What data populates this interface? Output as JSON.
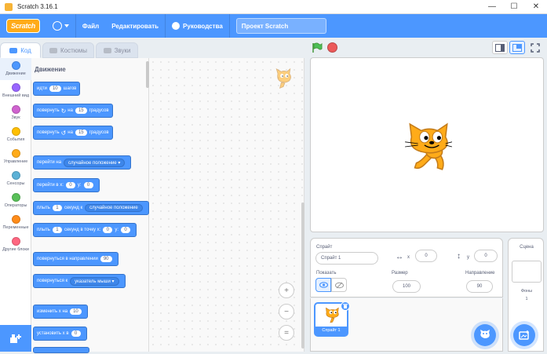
{
  "window": {
    "title": "Scratch 3.16.1",
    "minimize": "—",
    "maximize": "☐",
    "close": "✕"
  },
  "menubar": {
    "logo": "Scratch",
    "file": "Файл",
    "edit": "Редактировать",
    "tutorials": "Руководства",
    "project_title": "Проект Scratch"
  },
  "tabs": {
    "code": "Код",
    "costumes": "Костюмы",
    "sounds": "Звуки"
  },
  "categories": [
    {
      "label": "Движение",
      "color": "#4c97ff"
    },
    {
      "label": "Внешний вид",
      "color": "#9966ff"
    },
    {
      "label": "Звук",
      "color": "#cf63cf"
    },
    {
      "label": "События",
      "color": "#ffbf00"
    },
    {
      "label": "Управление",
      "color": "#ffab19"
    },
    {
      "label": "Сенсоры",
      "color": "#5cb1d6"
    },
    {
      "label": "Операторы",
      "color": "#59c059"
    },
    {
      "label": "Переменные",
      "color": "#ff8c1a"
    },
    {
      "label": "Другие блоки",
      "color": "#ff6680"
    }
  ],
  "palette": {
    "section": "Движение",
    "blocks": {
      "move": {
        "t1": "идти",
        "v1": "10",
        "t2": "шагов"
      },
      "turn_right": {
        "t1": "повернуть",
        "t2": "на",
        "v1": "15",
        "t3": "градусов"
      },
      "turn_left": {
        "t1": "повернуть",
        "t2": "на",
        "v1": "15",
        "t3": "градусов"
      },
      "goto": {
        "t1": "перейти на",
        "d1": "случайное положение"
      },
      "goto_xy": {
        "t1": "перейти в x:",
        "v1": "0",
        "t2": "y:",
        "v2": "0"
      },
      "glide_to": {
        "t1": "плыть",
        "v1": "1",
        "t2": "секунд к",
        "d1": "случайное положение"
      },
      "glide_xy": {
        "t1": "плыть",
        "v1": "1",
        "t2": "секунд в точку x:",
        "v2": "0",
        "t3": "y:",
        "v3": "0"
      },
      "point_dir": {
        "t1": "повернуться в направлении",
        "v1": "90"
      },
      "point_to": {
        "t1": "повернуться к",
        "d1": "указатель мыши"
      },
      "change_x": {
        "t1": "изменить x на",
        "v1": "10"
      },
      "set_x": {
        "t1": "установить x в",
        "v1": "0"
      }
    }
  },
  "zoom": {
    "in": "+",
    "out": "−",
    "reset": "="
  },
  "sprite_info": {
    "sprite_label": "Спрайт",
    "sprite_name": "Спрайт 1",
    "x_label": "x",
    "x_value": "0",
    "y_label": "y",
    "y_value": "0",
    "show_label": "Показать",
    "size_label": "Размер",
    "size_value": "100",
    "direction_label": "Направление",
    "direction_value": "90"
  },
  "sprites": [
    {
      "name": "Спрайт 1"
    }
  ],
  "stage_panel": {
    "title": "Сцена",
    "backdrops_label": "Фоны",
    "backdrops_count": "1"
  }
}
